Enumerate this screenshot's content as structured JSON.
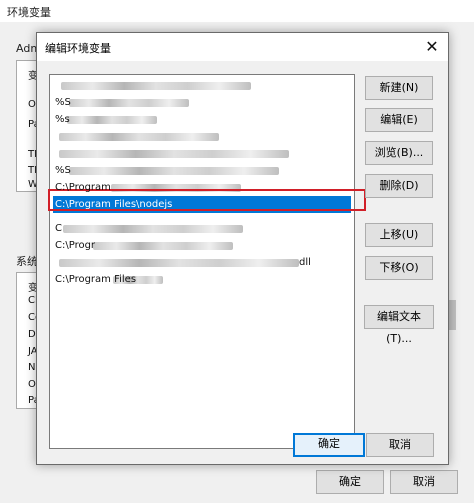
{
  "parent": {
    "title": "环境变量",
    "user_group_label": "Adm",
    "user_rows": [
      "变",
      "O",
      "Pa",
      "",
      "TE",
      "TM",
      "W"
    ],
    "system_group_label": "系统",
    "system_rows": [
      "变",
      "Cl",
      "Co",
      "Dr",
      "JA",
      "NI",
      "O",
      "Pa"
    ],
    "ok_label": "确定",
    "cancel_label": "取消"
  },
  "dialog": {
    "title": "编辑环境变量",
    "close_glyph": "✕",
    "entries": [
      {
        "text": "",
        "blurred": true
      },
      {
        "text": "%S",
        "blurred": true
      },
      {
        "text": "%s",
        "blurred": true
      },
      {
        "text": "",
        "blurred": true
      },
      {
        "text": "%S",
        "blurred": true
      },
      {
        "text": "C:\\Program",
        "blurred": true
      },
      {
        "text": "C:\\Program Files\\nodejs",
        "blurred": false,
        "selected": true
      },
      {
        "text": "C",
        "blurred": true
      },
      {
        "text": "C:\\Progr",
        "blurred": true
      },
      {
        "text": "dll",
        "blurred": true
      },
      {
        "text": "C:\\Program Files",
        "blurred": true
      }
    ],
    "buttons": {
      "new": "新建(N)",
      "edit": "编辑(E)",
      "browse": "浏览(B)...",
      "delete": "删除(D)",
      "move_up": "上移(U)",
      "move_down": "下移(O)",
      "edit_text": "编辑文本(T)..."
    },
    "ok_label": "确定",
    "cancel_label": "取消"
  }
}
